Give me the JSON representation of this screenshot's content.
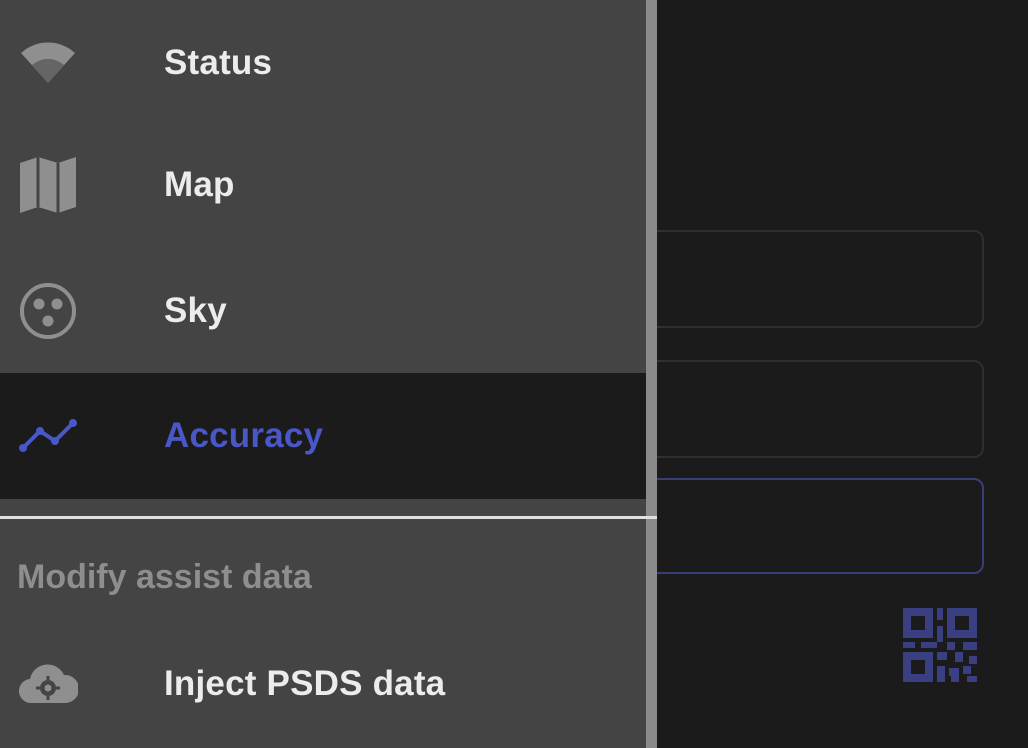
{
  "drawer": {
    "items": [
      {
        "label": "Status",
        "icon": "wifi-icon",
        "active": false
      },
      {
        "label": "Map",
        "icon": "map-icon",
        "active": false
      },
      {
        "label": "Sky",
        "icon": "sky-icon",
        "active": false
      },
      {
        "label": "Accuracy",
        "icon": "accuracy-graph-icon",
        "active": true
      }
    ],
    "section_header": "Modify assist data",
    "section_items": [
      {
        "label": "Inject PSDS data",
        "icon": "cloud-settings-icon"
      }
    ]
  },
  "background": {
    "qr_icon": "qr-code-icon"
  },
  "colors": {
    "drawer_bg": "#444444",
    "active_bg": "#1b1b1b",
    "accent": "#4a57c9",
    "text": "#ececec",
    "section_text": "#8e8e8e",
    "icon": "#8f8f8f"
  }
}
